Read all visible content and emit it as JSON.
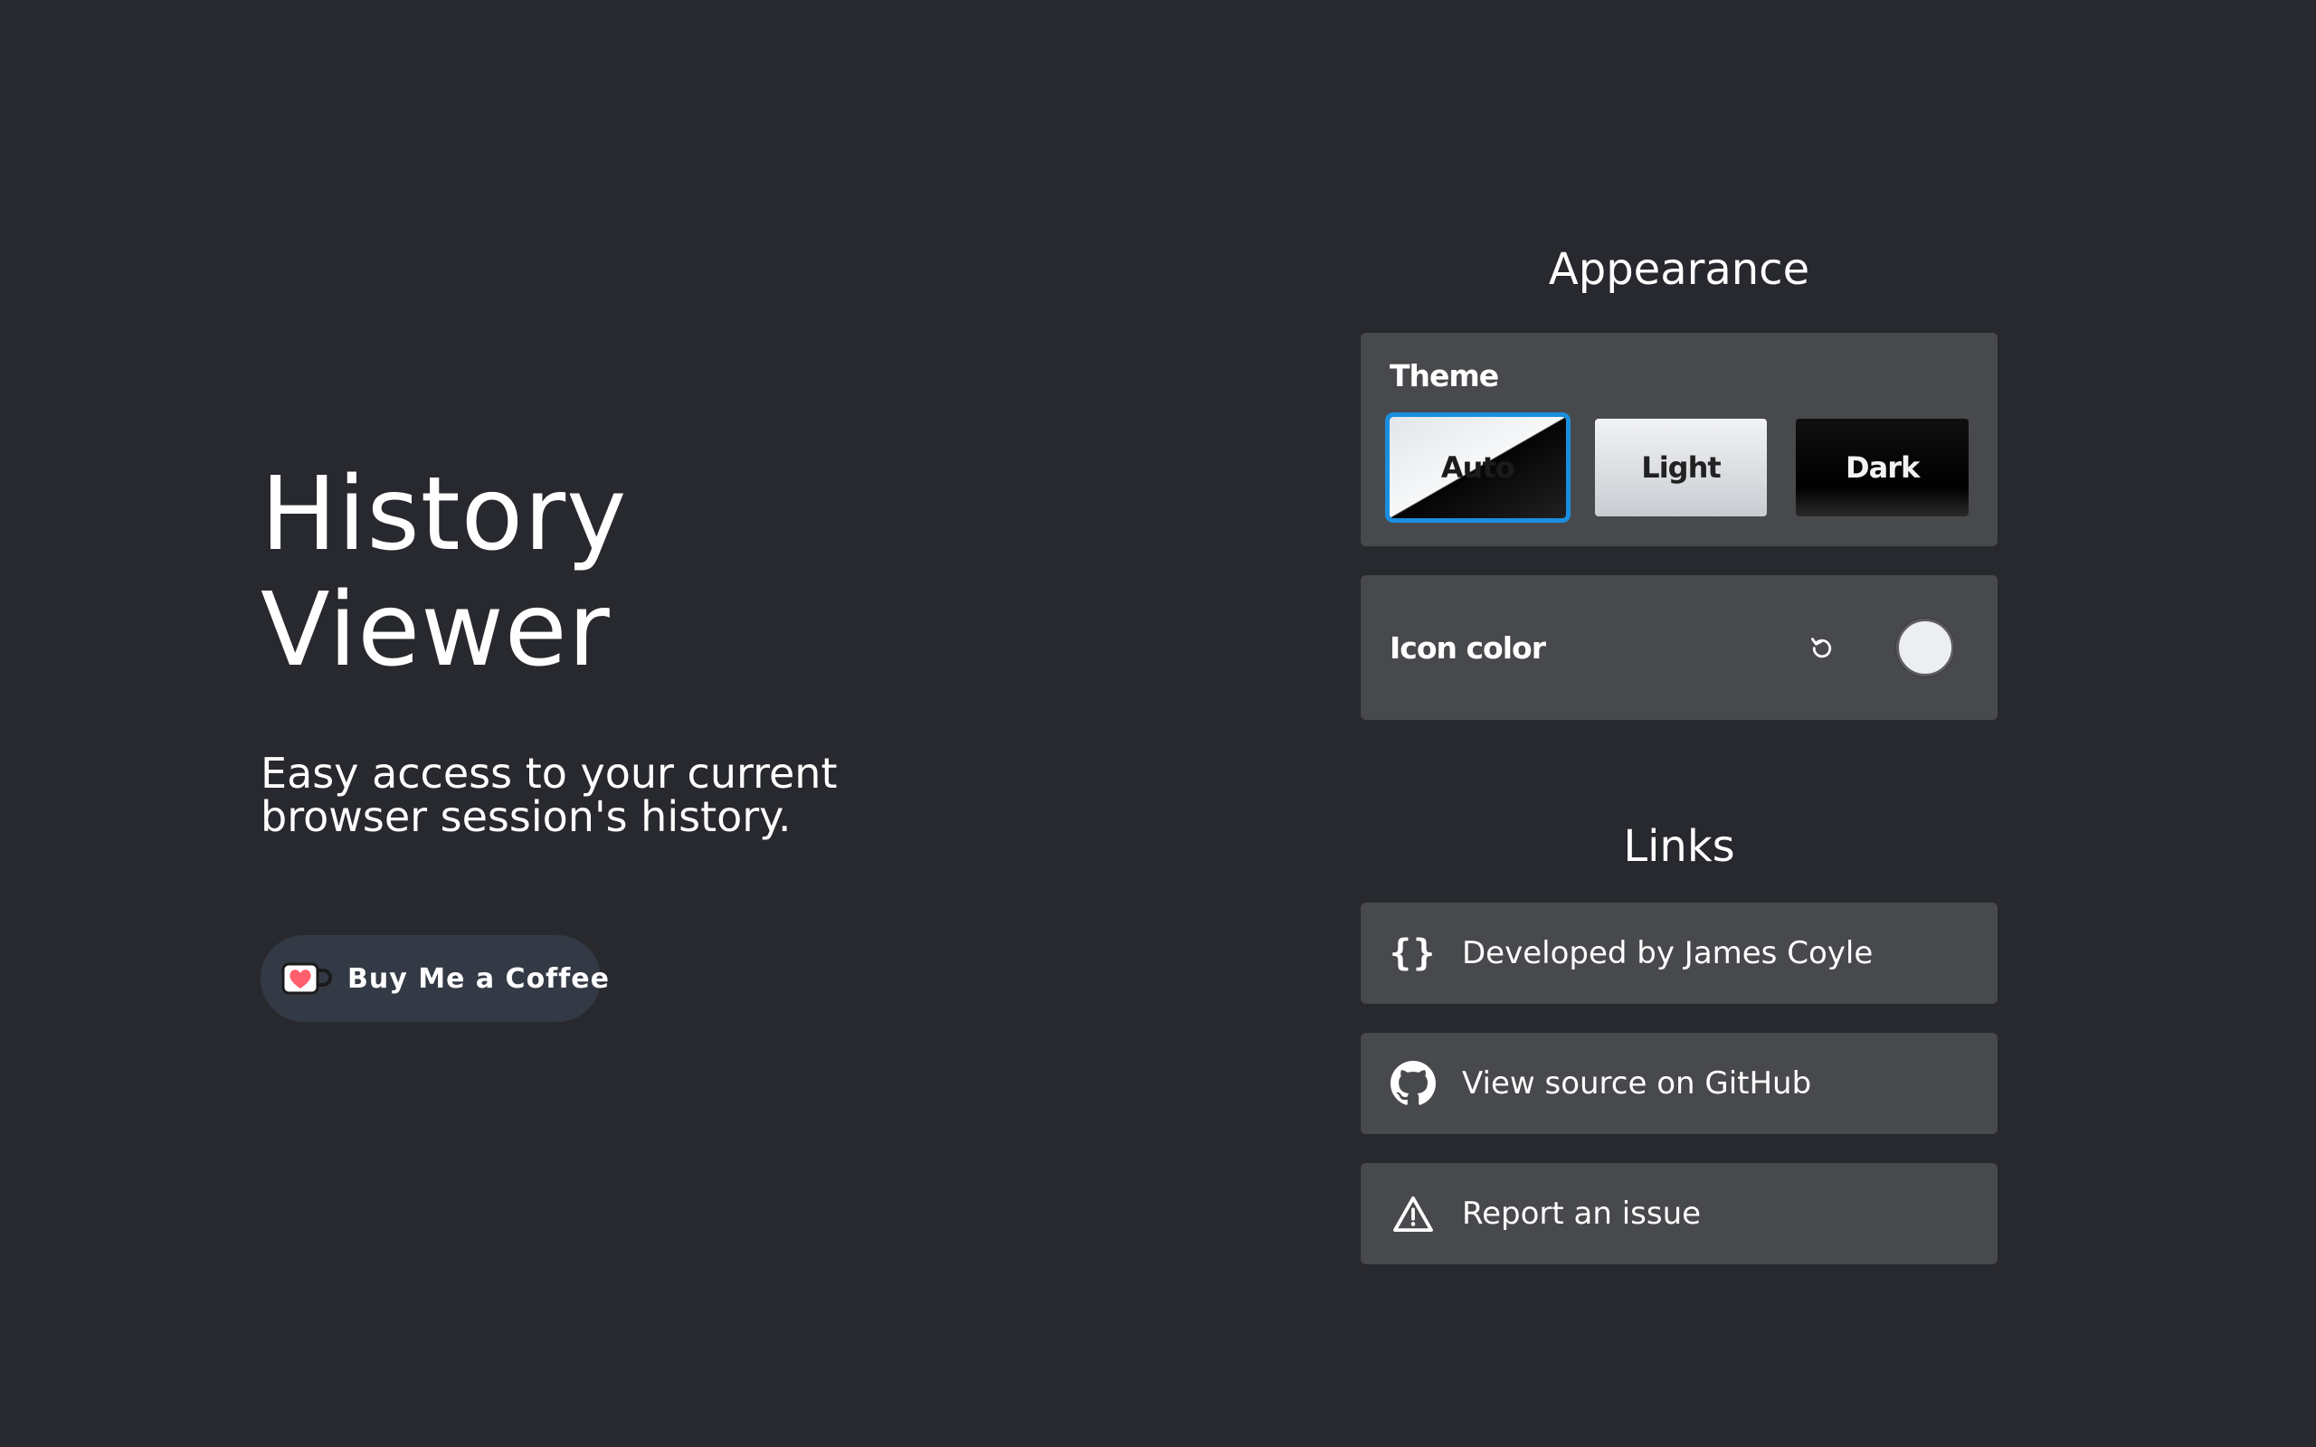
{
  "hero": {
    "title_line1": "History",
    "title_line2": "Viewer",
    "subtitle": "Easy access to your current browser session's history.",
    "coffee_label": "Buy Me a Coffee"
  },
  "appearance": {
    "heading": "Appearance",
    "theme_label": "Theme",
    "theme_options": [
      {
        "label": "Auto",
        "selected": true
      },
      {
        "label": "Light",
        "selected": false
      },
      {
        "label": "Dark",
        "selected": false
      }
    ],
    "icon_color_label": "Icon color",
    "icon_color_value": "#eceef1",
    "reset_icon": "reset-icon"
  },
  "links": {
    "heading": "Links",
    "items": [
      {
        "label": "Developed by James Coyle",
        "icon": "code-braces-icon"
      },
      {
        "label": "View source on GitHub",
        "icon": "github-icon"
      },
      {
        "label": "Report an issue",
        "icon": "warning-icon"
      }
    ]
  },
  "colors": {
    "background": "#28292e",
    "card": "#48494c",
    "accent": "#1a8fe0",
    "coffee_button": "#343a45"
  }
}
